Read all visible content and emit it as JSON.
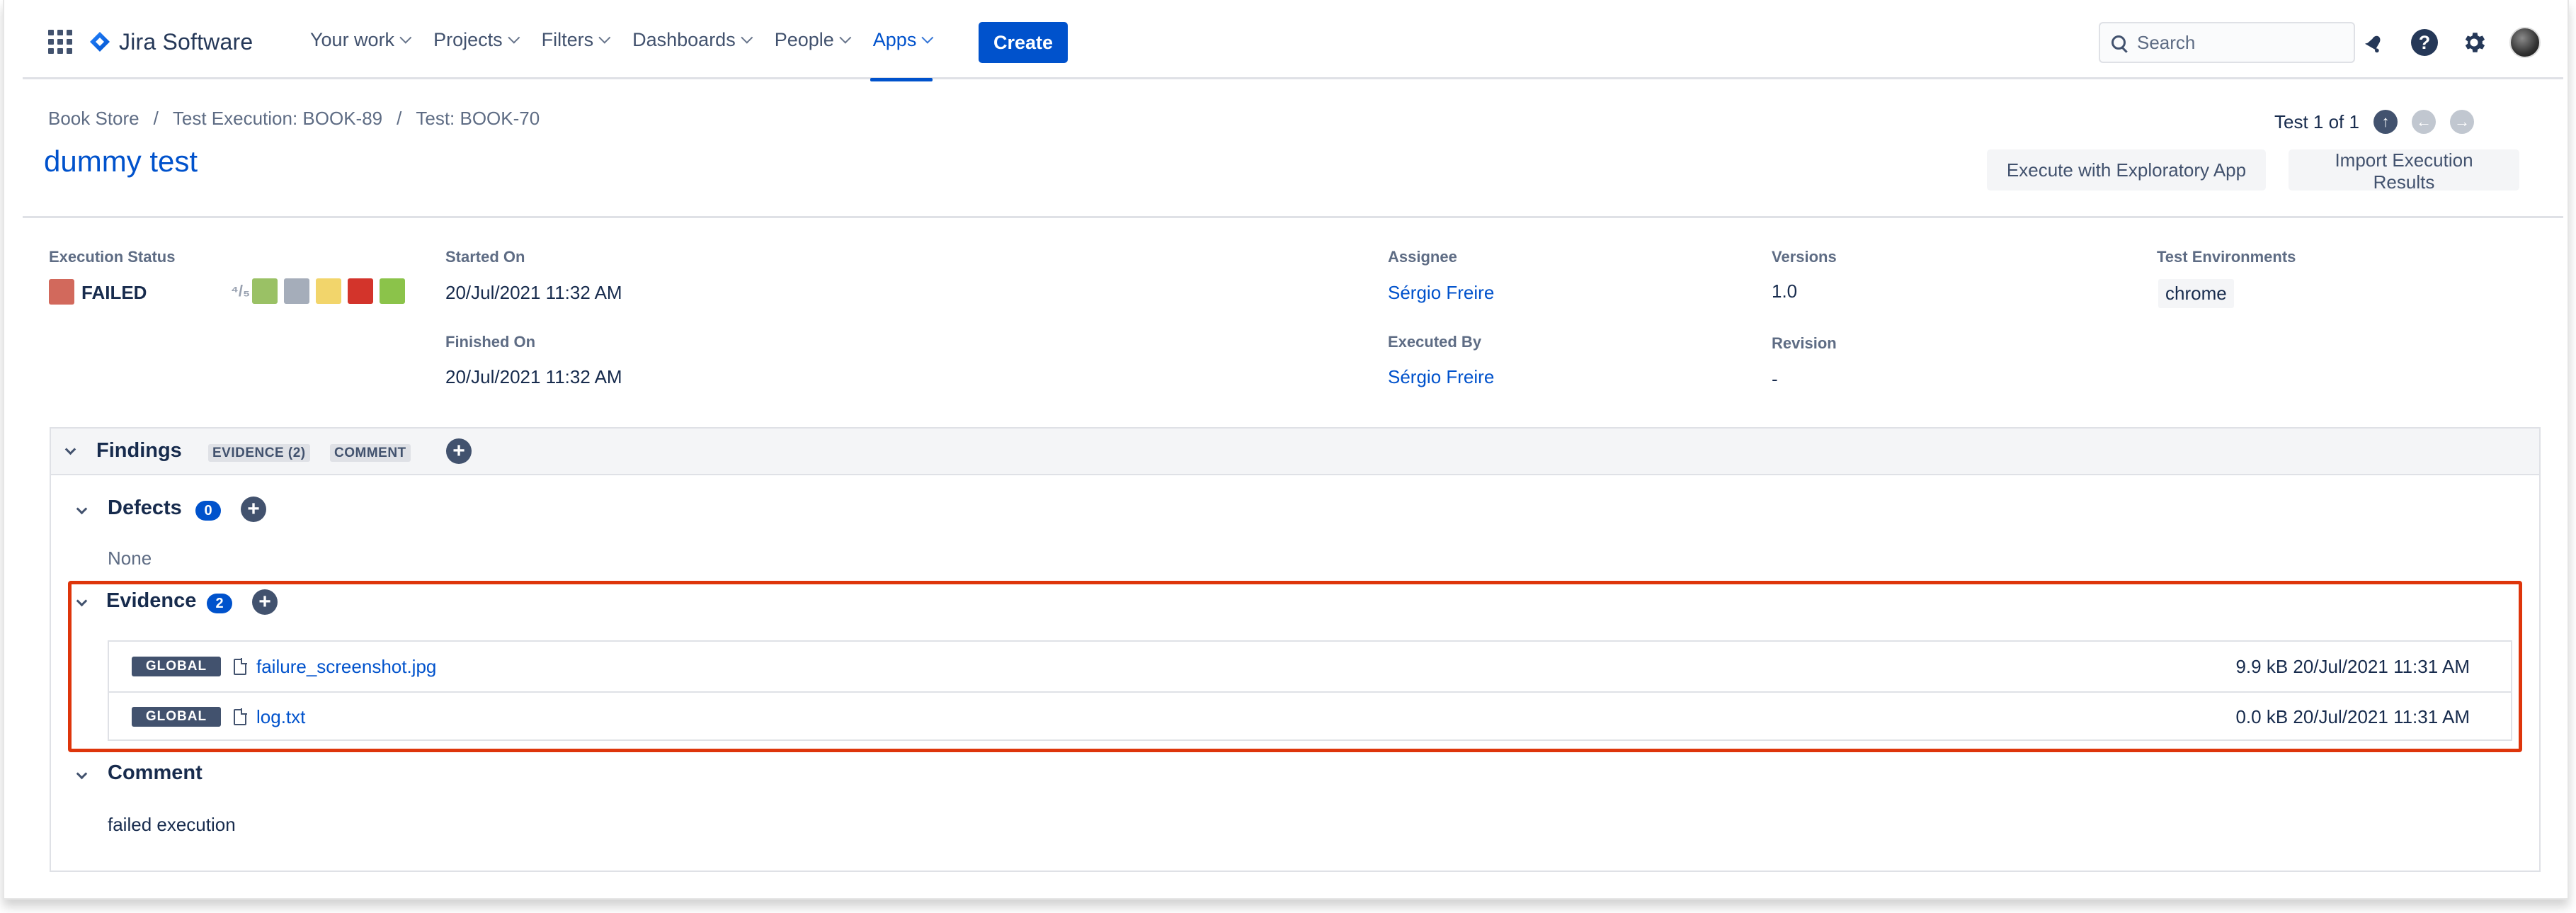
{
  "app": {
    "name": "Jira Software"
  },
  "nav": {
    "items": [
      {
        "label": "Your work"
      },
      {
        "label": "Projects"
      },
      {
        "label": "Filters"
      },
      {
        "label": "Dashboards"
      },
      {
        "label": "People"
      },
      {
        "label": "Apps"
      }
    ],
    "active": "Apps",
    "create_label": "Create",
    "search_placeholder": "Search"
  },
  "breadcrumb": [
    "Book Store",
    "Test Execution: BOOK-89",
    "Test: BOOK-70"
  ],
  "title": "dummy test",
  "pager": {
    "text": "Test 1 of 1"
  },
  "actions": {
    "exploratory": "Execute with Exploratory App",
    "import": "Import Execution Results"
  },
  "details": {
    "execution_status_label": "Execution Status",
    "status": "FAILED",
    "status_color": "#D2695C",
    "status_icon": "⁴/₅",
    "status_options": [
      "#9AC165",
      "#A5ADBA",
      "#F2D56B",
      "#D3342B",
      "#8BC34A"
    ],
    "started_on_label": "Started On",
    "started_on": "20/Jul/2021 11:32 AM",
    "finished_on_label": "Finished On",
    "finished_on": "20/Jul/2021 11:32 AM",
    "assignee_label": "Assignee",
    "assignee": "Sérgio Freire",
    "executed_by_label": "Executed By",
    "executed_by": "Sérgio Freire",
    "versions_label": "Versions",
    "versions": "1.0",
    "revision_label": "Revision",
    "revision": "-",
    "test_env_label": "Test Environments",
    "test_env": "chrome"
  },
  "findings": {
    "title": "Findings",
    "tabs": [
      "EVIDENCE (2)",
      "COMMENT"
    ],
    "defects": {
      "title": "Defects",
      "count": "0",
      "empty_text": "None"
    },
    "evidence": {
      "title": "Evidence",
      "count": "2",
      "items": [
        {
          "scope": "GLOBAL",
          "name": "failure_screenshot.jpg",
          "meta": "9.9 kB 20/Jul/2021 11:31 AM"
        },
        {
          "scope": "GLOBAL",
          "name": "log.txt",
          "meta": "0.0 kB 20/Jul/2021 11:31 AM"
        }
      ]
    },
    "comment": {
      "title": "Comment",
      "text": "failed execution"
    }
  },
  "colors": {
    "brand": "#0052CC",
    "highlight": "#DE350B"
  }
}
